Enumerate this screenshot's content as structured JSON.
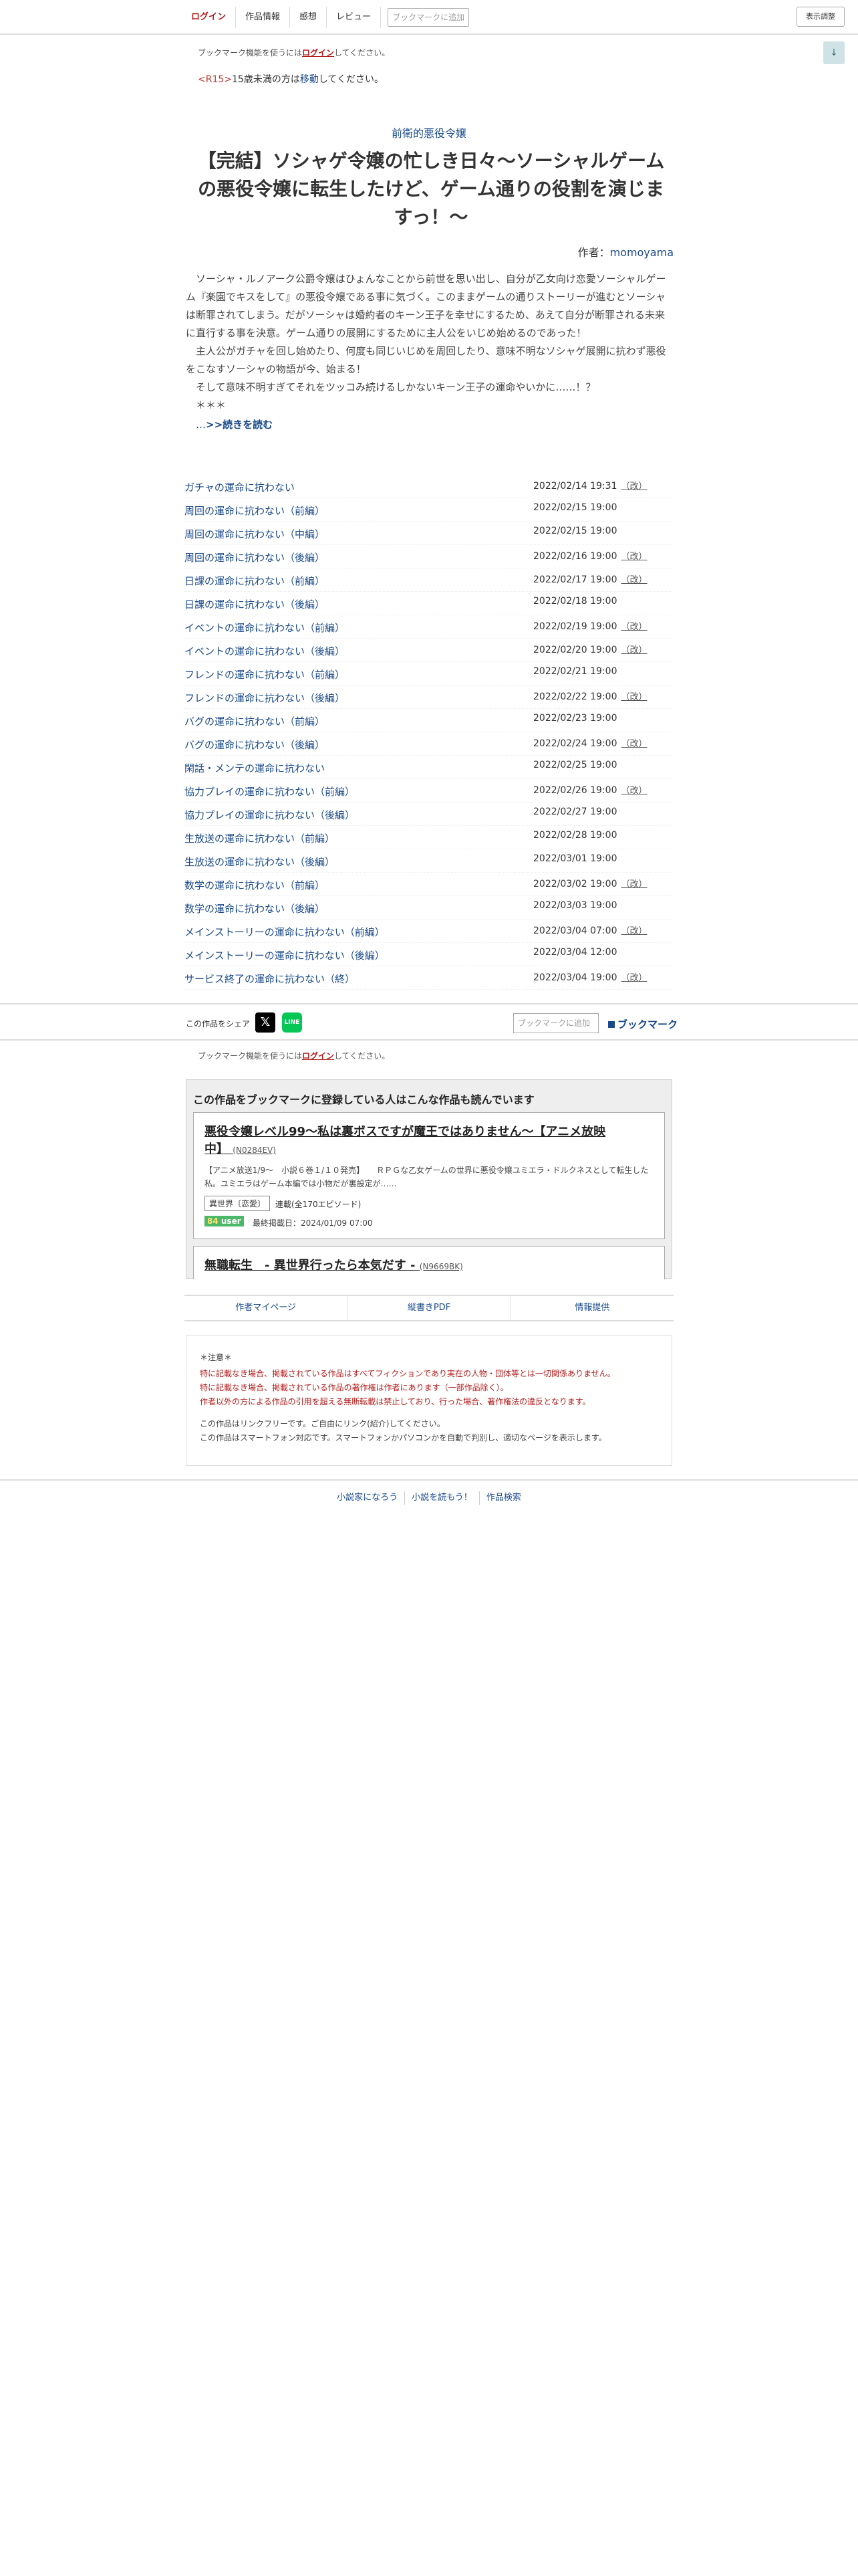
{
  "topbar": {
    "login": "ログイン",
    "info": "作品情報",
    "impression": "感想",
    "review": "レビュー",
    "bookmark_placeholder": "ブックマークに追加",
    "display": "表示調整"
  },
  "scroll_icon": "↓",
  "bookmark_note": {
    "prefix": "ブックマーク機能を使うには",
    "login": "ログイン",
    "suffix": "してください。"
  },
  "r15": {
    "tag": "<R15>",
    "text1": "15歳未満の方は",
    "link": "移動",
    "text2": "してください。"
  },
  "series": "前衛的悪役令嬢",
  "title": "【完結】ソシャゲ令嬢の忙しき日々〜ソーシャルゲームの悪役令嬢に転生したけど、ゲーム通りの役割を演じますっ！〜",
  "author": {
    "label": "作者：",
    "name": "momoyama"
  },
  "synopsis": [
    "ソーシャ・ルノアーク公爵令嬢はひょんなことから前世を思い出し、自分が乙女向け恋愛ソーシャルゲーム『楽園でキスをして』の悪役令嬢である事に気づく。このままゲームの通りストーリーが進むとソーシャは断罪されてしまう。だがソーシャは婚約者のキーン王子を幸せにするため、あえて自分が断罪される未来に直行する事を決意。ゲーム通りの展開にするために主人公をいじめ始めるのであった！",
    "主人公がガチャを回し始めたり、何度も同じいじめを周回したり、意味不明なソシャゲ展開に抗わず悪役をこなすソーシャの物語が今、始まる！",
    "そして意味不明すぎてそれをツッコみ続けるしかないキーン王子の運命やいかに……！？",
    "＊＊＊"
  ],
  "more": {
    "prefix": "…",
    "link": ">>続きを読む"
  },
  "chapters": [
    {
      "title": "ガチャの運命に抗わない",
      "date": "2022/02/14 19:31",
      "edit": "（改）"
    },
    {
      "title": "周回の運命に抗わない（前編）",
      "date": "2022/02/15 19:00",
      "edit": ""
    },
    {
      "title": "周回の運命に抗わない（中編）",
      "date": "2022/02/15 19:00",
      "edit": ""
    },
    {
      "title": "周回の運命に抗わない（後編）",
      "date": "2022/02/16 19:00",
      "edit": "（改）"
    },
    {
      "title": "日課の運命に抗わない（前編）",
      "date": "2022/02/17 19:00",
      "edit": "（改）"
    },
    {
      "title": "日課の運命に抗わない（後編）",
      "date": "2022/02/18 19:00",
      "edit": ""
    },
    {
      "title": "イベントの運命に抗わない（前編）",
      "date": "2022/02/19 19:00",
      "edit": "（改）"
    },
    {
      "title": "イベントの運命に抗わない（後編）",
      "date": "2022/02/20 19:00",
      "edit": "（改）"
    },
    {
      "title": "フレンドの運命に抗わない（前編）",
      "date": "2022/02/21 19:00",
      "edit": ""
    },
    {
      "title": "フレンドの運命に抗わない（後編）",
      "date": "2022/02/22 19:00",
      "edit": "（改）"
    },
    {
      "title": "バグの運命に抗わない（前編）",
      "date": "2022/02/23 19:00",
      "edit": ""
    },
    {
      "title": "バグの運命に抗わない（後編）",
      "date": "2022/02/24 19:00",
      "edit": "（改）"
    },
    {
      "title": "閑話・メンテの運命に抗わない",
      "date": "2022/02/25 19:00",
      "edit": ""
    },
    {
      "title": "協力プレイの運命に抗わない（前編）",
      "date": "2022/02/26 19:00",
      "edit": "（改）"
    },
    {
      "title": "協力プレイの運命に抗わない（後編）",
      "date": "2022/02/27 19:00",
      "edit": ""
    },
    {
      "title": "生放送の運命に抗わない（前編）",
      "date": "2022/02/28 19:00",
      "edit": ""
    },
    {
      "title": "生放送の運命に抗わない（後編）",
      "date": "2022/03/01 19:00",
      "edit": ""
    },
    {
      "title": "数学の運命に抗わない（前編）",
      "date": "2022/03/02 19:00",
      "edit": "（改）"
    },
    {
      "title": "数学の運命に抗わない（後編）",
      "date": "2022/03/03 19:00",
      "edit": ""
    },
    {
      "title": "メインストーリーの運命に抗わない（前編）",
      "date": "2022/03/04 07:00",
      "edit": "（改）"
    },
    {
      "title": "メインストーリーの運命に抗わない（後編）",
      "date": "2022/03/04 12:00",
      "edit": ""
    },
    {
      "title": "サービス終了の運命に抗わない（終）",
      "date": "2022/03/04 19:00",
      "edit": "（改）"
    }
  ],
  "share": {
    "label": "この作品をシェア",
    "x": "𝕏",
    "line": "LINE",
    "bookmark_placeholder": "ブックマークに追加",
    "bookmark": "ブックマーク"
  },
  "reco": {
    "heading": "この作品をブックマークに登録している人はこんな作品も読んでいます",
    "card1": {
      "title": "悪役令嬢レベル99〜私は裏ボスですが魔王ではありません〜【アニメ放映中】",
      "code": "(N0284EV)",
      "desc": "【アニメ放送1/9〜　小説６巻１/１０発売】　　ＲＰＧな乙女ゲームの世界に悪役令嬢ユミエラ・ドルクネスとして転生した私。ユミエラはゲーム本編では小物だが裏設定が……",
      "genre": "異世界〔恋愛〕",
      "eps": "連載(全170エピソード)",
      "user_num": "84",
      "user_label": " user",
      "updated": "最終掲載日：2024/01/09 07:00"
    },
    "card2": {
      "title": "無職転生　- 異世界行ったら本気だす -",
      "code": "(N9669BK)"
    }
  },
  "links3": [
    "作者マイページ",
    "縦書きPDF",
    "情報提供"
  ],
  "caution": {
    "head": "＊注意＊",
    "red": [
      "特に記載なき場合、掲載されている作品はすべてフィクションであり実在の人物・団体等とは一切関係ありません。",
      "特に記載なき場合、掲載されている作品の著作権は作者にあります（一部作品除く）。",
      "作者以外の方による作品の引用を超える無断転載は禁止しており、行った場合、著作権法の違反となります。"
    ],
    "gray": [
      "この作品はリンクフリーです。ご自由にリンク(紹介)してください。",
      "この作品はスマートフォン対応です。スマートフォンかパソコンかを自動で判別し、適切なページを表示します。"
    ]
  },
  "footer": [
    "小説家になろう",
    "小説を読もう！",
    "作品検索"
  ]
}
